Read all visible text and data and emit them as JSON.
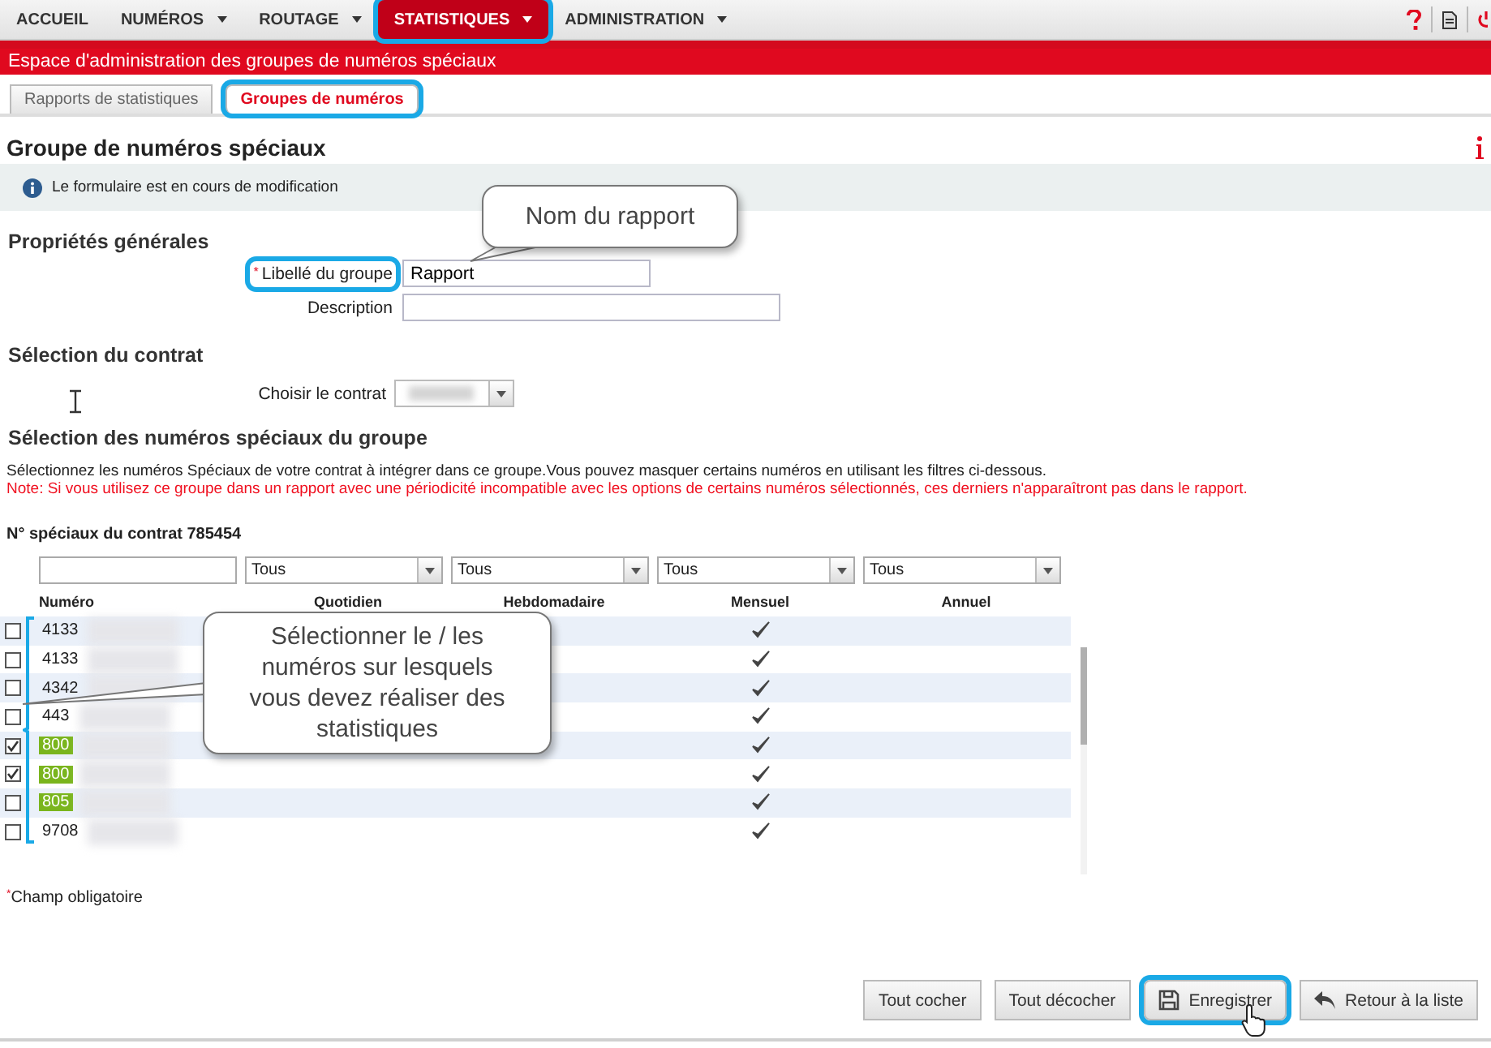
{
  "nav": {
    "items": [
      {
        "label": "ACCUEIL",
        "dropdown": false,
        "selected": false,
        "highlighted": false
      },
      {
        "label": "NUMÉROS",
        "dropdown": true,
        "selected": false,
        "highlighted": false
      },
      {
        "label": "ROUTAGE",
        "dropdown": true,
        "selected": false,
        "highlighted": false
      },
      {
        "label": "STATISTIQUES",
        "dropdown": true,
        "selected": true,
        "highlighted": true
      },
      {
        "label": "ADMINISTRATION",
        "dropdown": true,
        "selected": false,
        "highlighted": false
      }
    ]
  },
  "banner": {
    "title": "Espace d'administration des groupes de numéros spéciaux"
  },
  "tabs": [
    {
      "label": "Rapports de statistiques",
      "selected": false,
      "highlighted": false
    },
    {
      "label": "Groupes de numéros",
      "selected": true,
      "highlighted": true
    }
  ],
  "page_title": "Groupe de numéros spéciaux",
  "info_message": "Le formulaire est en cours de modification",
  "general": {
    "heading": "Propriétés générales",
    "fields": [
      {
        "label": "Libellé du groupe",
        "marker": "*",
        "highlighted": true,
        "value": "Rapport"
      },
      {
        "label": "Description",
        "highlighted": false
      }
    ]
  },
  "contract": {
    "heading": "Sélection du contrat",
    "label": "Choisir le contrat"
  },
  "numbers": {
    "heading": "Sélection des numéros spéciaux du groupe",
    "description": "Sélectionnez les numéros Spéciaux de votre contrat à intégrer dans ce groupe.Vous pouvez masquer certains numéros en utilisant les filtres ci-dessous.",
    "note": "Note: Si vous utilisez ce groupe dans un rapport avec une périodicité incompatible avec les options de certains numéros sélectionnés, ces derniers n'apparaîtront pas dans le rapport.",
    "table_title": "N° spéciaux du contrat 785454",
    "filters": [
      "Tous",
      "Tous",
      "Tous",
      "Tous"
    ],
    "columns": [
      "Numéro",
      "Quotidien",
      "Hebdomadaire",
      "Mensuel",
      "Annuel"
    ],
    "rows": [
      {
        "number": "4133",
        "checked": false,
        "highlighted": false,
        "monthly": true
      },
      {
        "number": "4133",
        "checked": false,
        "highlighted": false,
        "monthly": true
      },
      {
        "number": "4342",
        "checked": false,
        "highlighted": false,
        "monthly": true
      },
      {
        "number": "443",
        "checked": false,
        "highlighted": false,
        "monthly": true
      },
      {
        "number": "800",
        "checked": true,
        "highlighted": true,
        "monthly": true
      },
      {
        "number": "800",
        "checked": true,
        "highlighted": true,
        "monthly": true
      },
      {
        "number": "805",
        "checked": false,
        "highlighted": true,
        "monthly": true
      },
      {
        "number": "9708",
        "checked": false,
        "highlighted": false,
        "monthly": true
      }
    ]
  },
  "required_note": {
    "marker": "*",
    "text": "Champ obligatoire"
  },
  "buttons": [
    {
      "label": "Tout cocher",
      "kind": "plain",
      "highlighted": false
    },
    {
      "label": "Tout décocher",
      "kind": "plain",
      "highlighted": false
    },
    {
      "label": "Enregistrer",
      "kind": "save",
      "highlighted": true
    },
    {
      "label": "Retour à la liste",
      "kind": "back",
      "highlighted": false
    }
  ],
  "callouts": [
    {
      "text": "Nom du rapport"
    },
    {
      "text": "Sélectionner le / les numéros sur lesquels vous devez réaliser des statistiques"
    }
  ]
}
